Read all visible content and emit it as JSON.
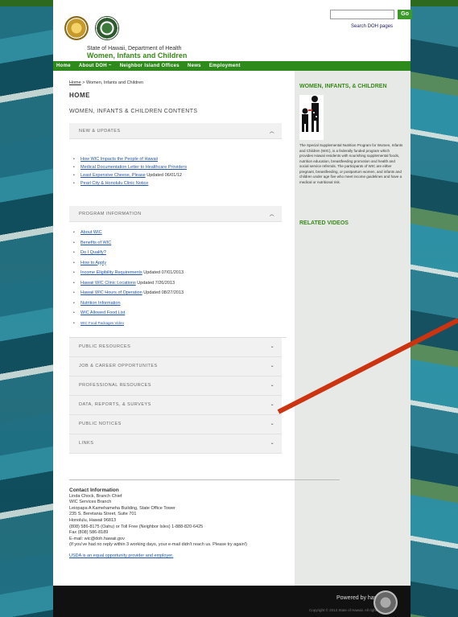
{
  "header": {
    "state_line": "State of Hawaii, Department of Health",
    "agency": "Women, Infants and Children",
    "search_placeholder": "",
    "go_label": "Go",
    "search_label": "Search DOH pages"
  },
  "nav": [
    "Home",
    "About DOH ~",
    "Neighbor Island Offices",
    "News",
    "Employment"
  ],
  "breadcrumb": {
    "home": "Home",
    "rest": " > Women, Infants and Children"
  },
  "main": {
    "home_heading": "HOME",
    "contents_heading": "WOMEN, INFANTS & CHILDREN CONTENTS",
    "sections": [
      {
        "title": "NEW & UPDATES",
        "expanded": true,
        "items": [
          {
            "link": "How WIC Impacts the People of Hawaii",
            "note": ""
          },
          {
            "link": "Medical Documentation Letter to Healthcare Providers",
            "note": ""
          },
          {
            "link": "Least Expensive Cheese, Please",
            "note": " Updated 06/01/12"
          },
          {
            "link": "Pearl City & Honolulu Clinic Notice",
            "note": ""
          }
        ]
      },
      {
        "title": "PROGRAM INFORMATION",
        "expanded": true,
        "items": [
          {
            "link": "About WIC",
            "note": ""
          },
          {
            "link": "Benefits of WIC",
            "note": ""
          },
          {
            "link": "Do I Qualify?",
            "note": ""
          },
          {
            "link": "How to Apply",
            "note": ""
          },
          {
            "link": "Income Eligibility Requirements",
            "note": " Updated 07/01/2013"
          },
          {
            "link": "Hawaii WIC Clinic Locations",
            "note": " Updated 7/26/2013"
          },
          {
            "link": "Hawaii WIC Hours of Operation",
            "note": " Updated 08/27/2013"
          },
          {
            "link": "Nutrition Information",
            "note": ""
          },
          {
            "link": "WIC Allowed Food List",
            "note": ""
          },
          {
            "link": "WIC Food Packages Video",
            "note": ""
          }
        ]
      },
      {
        "title": "PUBLIC RESOURCES",
        "expanded": false,
        "items": []
      },
      {
        "title": "JOB & CAREER OPPORTUNITES",
        "expanded": false,
        "items": []
      },
      {
        "title": "PROFESSIONAL RESOURCES",
        "expanded": false,
        "items": []
      },
      {
        "title": "DATA, REPORTS, & SURVEYS",
        "expanded": false,
        "items": []
      },
      {
        "title": "PUBLIC NOTICES",
        "expanded": false,
        "items": []
      },
      {
        "title": "LINKS",
        "expanded": false,
        "items": []
      }
    ],
    "chevron_up": "︿",
    "chevron_down": "⌄"
  },
  "sidebar": {
    "title": "WOMEN, INFANTS, & CHILDREN",
    "text": "The Special Supplemental Nutrition Program for Women, Infants and Children (WIC), is a federally funded program which provides Hawaii residents with nourishing supplemental foods, nutrition education, breastfeeding promotion and health and social service referrals. The participants of WIC are either pregnant, breastfeeding, or postpartum women, and infants and children under age five who meet income guidelines and have a medical or nutritional risk.",
    "related": "RELATED VIDEOS"
  },
  "contact": {
    "heading": "Contact Information",
    "lines": [
      "Linda Chock, Branch Chief",
      "WIC Services Branch",
      "Leiopapa A Kamehameha Building, State Office Tower",
      "235 S. Beretania Street, Suite 701",
      "Honolulu, Hawaii 96813",
      "(808) 586-8175 (Oahu) or Toll Free (Neighbor Isles) 1-888-820-6425",
      "Fax (808) 586-8189",
      "E-mail: wic@doh.hawaii.gov",
      "(If you've had no reply within 3 working days, your e-mail didn't reach us. Please try again!)"
    ],
    "equal_opportunity": "USDA is an equal opportunity provider and employer."
  },
  "footer": {
    "powered": "Powered by  hawaii.gov",
    "copyright": "Copyright © 2013 State of Hawaii. All rights reserved."
  },
  "colors": {
    "green": "#2f8a1c",
    "title_green": "#3a8a1a",
    "annotation_red": "#cc3311"
  }
}
